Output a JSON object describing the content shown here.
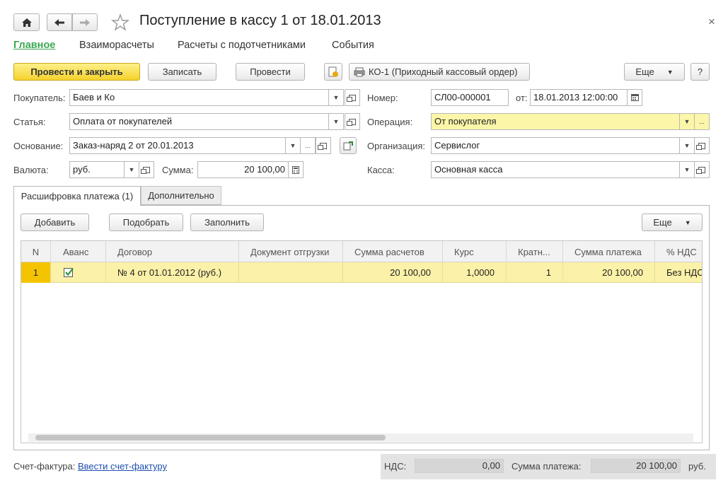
{
  "window": {
    "title": "Поступление в кассу 1 от 18.01.2013",
    "close_glyph": "×"
  },
  "nav_tabs": [
    {
      "label": "Главное"
    },
    {
      "label": "Взаиморасчеты"
    },
    {
      "label": "Расчеты с подотчетниками"
    },
    {
      "label": "События"
    }
  ],
  "toolbar": {
    "post_close": "Провести и закрыть",
    "save": "Записать",
    "post": "Провести",
    "print": "КО-1 (Приходный кассовый ордер)",
    "more": "Еще",
    "help": "?"
  },
  "form": {
    "buyer_label": "Покупатель:",
    "buyer_value": "Баев и Ко",
    "article_label": "Статья:",
    "article_value": "Оплата от покупателей",
    "basis_label": "Основание:",
    "basis_value": "Заказ-наряд 2 от 20.01.2013",
    "currency_label": "Валюта:",
    "currency_value": "руб.",
    "sum_label": "Сумма:",
    "sum_value": "20 100,00",
    "number_label": "Номер:",
    "number_value": "СЛ00-000001",
    "date_label": "от:",
    "date_value": "18.01.2013 12:00:00",
    "operation_label": "Операция:",
    "operation_value": "От покупателя",
    "org_label": "Организация:",
    "org_value": "Сервислог",
    "cash_label": "Касса:",
    "cash_value": "Основная касса",
    "ellipsis": "..."
  },
  "inner_tabs": [
    {
      "label": "Расшифровка платежа (1)"
    },
    {
      "label": "Дополнительно"
    }
  ],
  "table_toolbar": {
    "add": "Добавить",
    "pick": "Подобрать",
    "fill": "Заполнить",
    "more": "Еще"
  },
  "table": {
    "columns": [
      "N",
      "Аванс",
      "Договор",
      "Документ отгрузки",
      "Сумма расчетов",
      "Курс",
      "Кратн...",
      "Сумма платежа",
      "% НДС"
    ],
    "rows": [
      {
        "n": "1",
        "advance": true,
        "contract": "№ 4 от 01.01.2012 (руб.)",
        "shipment": "",
        "settlement_sum": "20 100,00",
        "rate": "1,0000",
        "multiplicity": "1",
        "payment_sum": "20 100,00",
        "vat": "Без НДС"
      }
    ]
  },
  "footer": {
    "invoice_label": "Счет-фактура:",
    "invoice_link": "Ввести счет-фактуру",
    "vat_label": "НДС:",
    "vat_value": "0,00",
    "payment_label": "Сумма платежа:",
    "payment_value": "20 100,00",
    "currency": "руб."
  }
}
